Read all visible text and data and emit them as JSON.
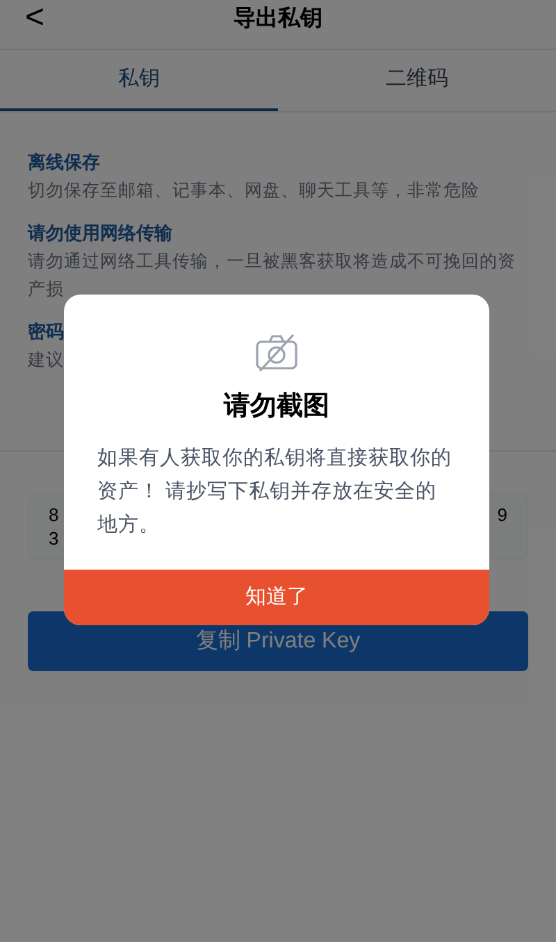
{
  "header": {
    "back": "<",
    "title": "导出私钥"
  },
  "tabs": [
    {
      "label": "私钥",
      "selected": true
    },
    {
      "label": "二维码",
      "selected": false
    }
  ],
  "sections": [
    {
      "heading": "离线保存",
      "body": "切勿保存至邮箱、记事本、网盘、聊天工具等，非常危险"
    },
    {
      "heading": "请勿使用网络传输",
      "body": "请勿通过网络工具传输，一旦被黑客获取将造成不可挽回的资产损"
    },
    {
      "heading": "密码",
      "body": "建议"
    }
  ],
  "key_box": {
    "left_lines": [
      "8",
      "3"
    ],
    "right_lines": [
      "9"
    ]
  },
  "copy_button": "复制 Private Key",
  "dialog": {
    "title": "请勿截图",
    "message": "如果有人获取你的私钥将直接获取你的资产！ 请抄写下私钥并存放在安全的地方。",
    "button": "知道了"
  }
}
